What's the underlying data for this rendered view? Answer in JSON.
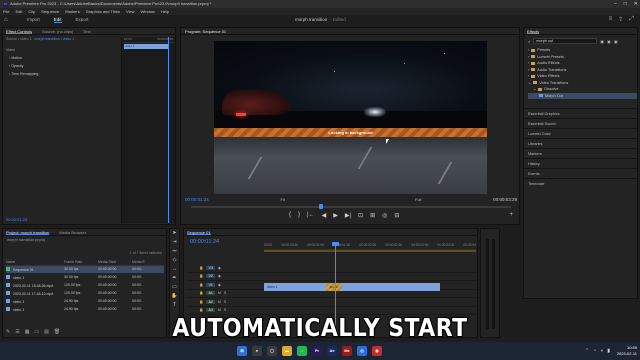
{
  "window": {
    "title": "Adobe Premiere Pro 2023 - C:\\Users\\AdobeBasics\\Documents\\Adobe\\Premiere Pro\\23.0\\morph transition.prproj *",
    "app_badge": "Pr"
  },
  "menu": [
    "File",
    "Edit",
    "Clip",
    "Sequence",
    "Markers",
    "Graphics and Titles",
    "View",
    "Window",
    "Help"
  ],
  "workspace": {
    "tabs": [
      "Import",
      "Edit",
      "Export"
    ],
    "active": "Edit",
    "project_name": "morph transition",
    "project_sub": "- Edited"
  },
  "effect_controls": {
    "tabs": [
      "Effect Controls",
      "Source: (no clips)",
      "Text"
    ],
    "source_line": [
      "Source • video 1",
      "morph transition • video 1"
    ],
    "section": "Video",
    "rows": [
      "Motion",
      "Opacity",
      "Time Remapping"
    ],
    "ruler": [
      "00:00",
      "00:00:05:00"
    ],
    "clip_label": "video 1",
    "timecode": "00:00:01:24"
  },
  "program": {
    "title": "Program: Sequence 01",
    "banner_text": "Looking in background",
    "timecode": "00:00:01:24",
    "fit": "Fit",
    "quality": "Full",
    "duration": "00:00:03:29",
    "transport": [
      "{",
      "}",
      "|←",
      "◀",
      "▶",
      "▶|",
      "⊡",
      "⊞",
      "◎",
      "⊟"
    ]
  },
  "effects": {
    "title": "Effects",
    "search_value": "morph cut",
    "tree": [
      {
        "label": "Presets",
        "type": "folder",
        "depth": 0
      },
      {
        "label": "Lumetri Presets",
        "type": "folder",
        "depth": 0
      },
      {
        "label": "Audio Effects",
        "type": "folder",
        "depth": 0
      },
      {
        "label": "Audio Transitions",
        "type": "folder",
        "depth": 0
      },
      {
        "label": "Video Effects",
        "type": "folder",
        "depth": 0
      },
      {
        "label": "Video Transitions",
        "type": "folder",
        "depth": 0
      },
      {
        "label": "Dissolve",
        "type": "folder",
        "depth": 1
      },
      {
        "label": "Morph Cut",
        "type": "clip",
        "depth": 2,
        "selected": true
      }
    ],
    "lower": [
      "Essential Graphics",
      "Essential Sound",
      "Lumetri Color",
      "Libraries",
      "Markers",
      "History",
      "Events",
      "Timecode"
    ]
  },
  "project": {
    "tabs": [
      "Project: morph transition",
      "Media Browser"
    ],
    "bin": "morph transition.prproj",
    "meta": "1 of 7 items selected",
    "columns": [
      "Name",
      "Frame Rate",
      "Media Start",
      "Media E"
    ],
    "rows": [
      {
        "name": "Sequence 01",
        "fps": "30.00 fps",
        "start": "00:00:00:00",
        "end": "00:00:",
        "color": "#3dba79"
      },
      {
        "name": "video 1",
        "fps": "30.00 fps",
        "start": "00:00:00:00",
        "end": "00:00:",
        "color": "#6fa7e3"
      },
      {
        "name": "2023-02-11 18-48-06.mp4",
        "fps": "120.00 fps",
        "start": "00:00:00:00",
        "end": "00:00:",
        "color": "#6fa7e3"
      },
      {
        "name": "2023-02-11 17-46-10.mp4",
        "fps": "120.00 fps",
        "start": "00:00:00:00",
        "end": "00:00:",
        "color": "#6fa7e3"
      },
      {
        "name": "video 1",
        "fps": "24.00 fps",
        "start": "00:00:00:00",
        "end": "00:00:",
        "color": "#6fa7e3"
      },
      {
        "name": "video 1",
        "fps": "24.00 fps",
        "start": "00:00:00:00",
        "end": "00:00:",
        "color": "#6fa7e3"
      }
    ]
  },
  "timeline": {
    "title": "Sequence 01",
    "timecode": "00:00:01:24",
    "ruler": [
      "00:00",
      "00:00:00:30",
      "00:00:01:00",
      "00:00:01:30",
      "00:00:02:00",
      "00:00:02:30",
      "00:00:03:00",
      "00:00:03:30",
      "00:00:04"
    ],
    "tracks": [
      "V3",
      "V2",
      "V1",
      "A1",
      "A2",
      "A3"
    ],
    "clip_label": "video 1",
    "transition_label": "Morph"
  },
  "caption": "AUTOMATICALLY START",
  "taskbar": {
    "time": "10:59",
    "date": "2023-02-11"
  }
}
